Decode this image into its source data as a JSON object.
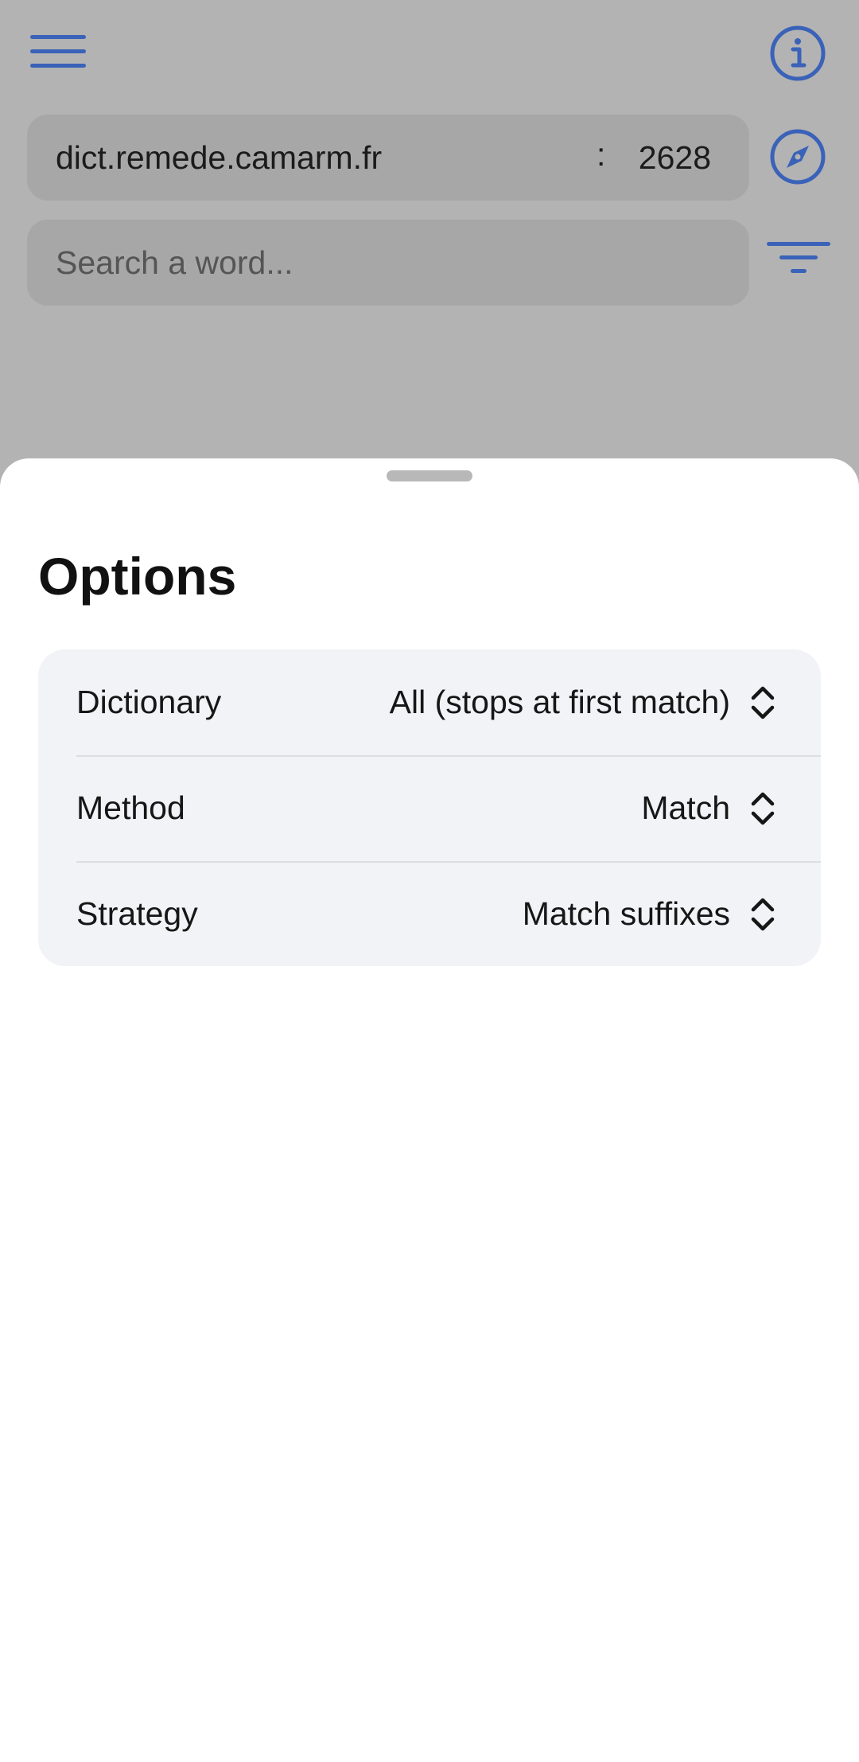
{
  "toolbar": {
    "menu_icon": "hamburger-menu-icon",
    "info_icon": "info-circle-icon",
    "compass_icon": "compass-icon",
    "filter_icon": "filter-lines-icon",
    "accent_color": "#3a62b8"
  },
  "server": {
    "host": "dict.remede.camarm.fr",
    "separator": ":",
    "port": "2628"
  },
  "search": {
    "placeholder": "Search a word..."
  },
  "sheet": {
    "title": "Options",
    "options": [
      {
        "label": "Dictionary",
        "value": "All (stops at first match)"
      },
      {
        "label": "Method",
        "value": "Match"
      },
      {
        "label": "Strategy",
        "value": "Match suffixes"
      }
    ]
  }
}
